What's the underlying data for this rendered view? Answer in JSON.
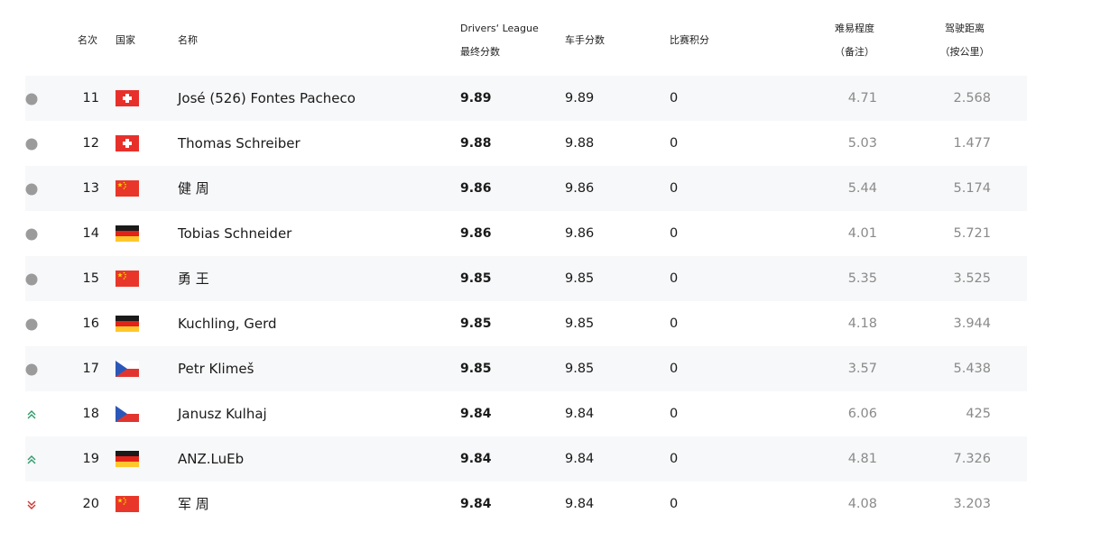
{
  "header": {
    "rank": "名次",
    "country": "国家",
    "name": "名称",
    "final_score_line1": "Drivers‘ League",
    "final_score_line2": "最终分数",
    "driver_score": "车手分数",
    "match_points": "比赛积分",
    "difficulty_line1": "难易程度",
    "difficulty_line2": "（备注）",
    "distance_line1": "驾驶距离",
    "distance_line2": "（按公里）"
  },
  "colors": {
    "neutral": "#9b9b9b",
    "up": "#2e9a6a",
    "down": "#d0322a",
    "row_alt_bg": "#f7f8f9"
  },
  "rows": [
    {
      "trend": "neutral",
      "rank": "11",
      "country": "switzerland-flag",
      "name": "José (526) Fontes Pacheco",
      "final": "9.89",
      "driver": "9.89",
      "points": "0",
      "difficulty": "4.71",
      "distance": "2.568"
    },
    {
      "trend": "neutral",
      "rank": "12",
      "country": "switzerland-flag",
      "name": "Thomas Schreiber",
      "final": "9.88",
      "driver": "9.88",
      "points": "0",
      "difficulty": "5.03",
      "distance": "1.477"
    },
    {
      "trend": "neutral",
      "rank": "13",
      "country": "china-flag",
      "name": "健 周",
      "final": "9.86",
      "driver": "9.86",
      "points": "0",
      "difficulty": "5.44",
      "distance": "5.174"
    },
    {
      "trend": "neutral",
      "rank": "14",
      "country": "germany-flag",
      "name": "Tobias Schneider",
      "final": "9.86",
      "driver": "9.86",
      "points": "0",
      "difficulty": "4.01",
      "distance": "5.721"
    },
    {
      "trend": "neutral",
      "rank": "15",
      "country": "china-flag",
      "name": "勇 王",
      "final": "9.85",
      "driver": "9.85",
      "points": "0",
      "difficulty": "5.35",
      "distance": "3.525"
    },
    {
      "trend": "neutral",
      "rank": "16",
      "country": "germany-flag",
      "name": "Kuchling, Gerd",
      "final": "9.85",
      "driver": "9.85",
      "points": "0",
      "difficulty": "4.18",
      "distance": "3.944"
    },
    {
      "trend": "neutral",
      "rank": "17",
      "country": "czech-flag",
      "name": "Petr Klimeš",
      "final": "9.85",
      "driver": "9.85",
      "points": "0",
      "difficulty": "3.57",
      "distance": "5.438"
    },
    {
      "trend": "up",
      "rank": "18",
      "country": "czech-flag",
      "name": "Janusz Kulhaj",
      "final": "9.84",
      "driver": "9.84",
      "points": "0",
      "difficulty": "6.06",
      "distance": "425"
    },
    {
      "trend": "up",
      "rank": "19",
      "country": "germany-flag",
      "name": "ANZ.LuEb",
      "final": "9.84",
      "driver": "9.84",
      "points": "0",
      "difficulty": "4.81",
      "distance": "7.326"
    },
    {
      "trend": "down",
      "rank": "20",
      "country": "china-flag",
      "name": "军 周",
      "final": "9.84",
      "driver": "9.84",
      "points": "0",
      "difficulty": "4.08",
      "distance": "3.203"
    }
  ]
}
